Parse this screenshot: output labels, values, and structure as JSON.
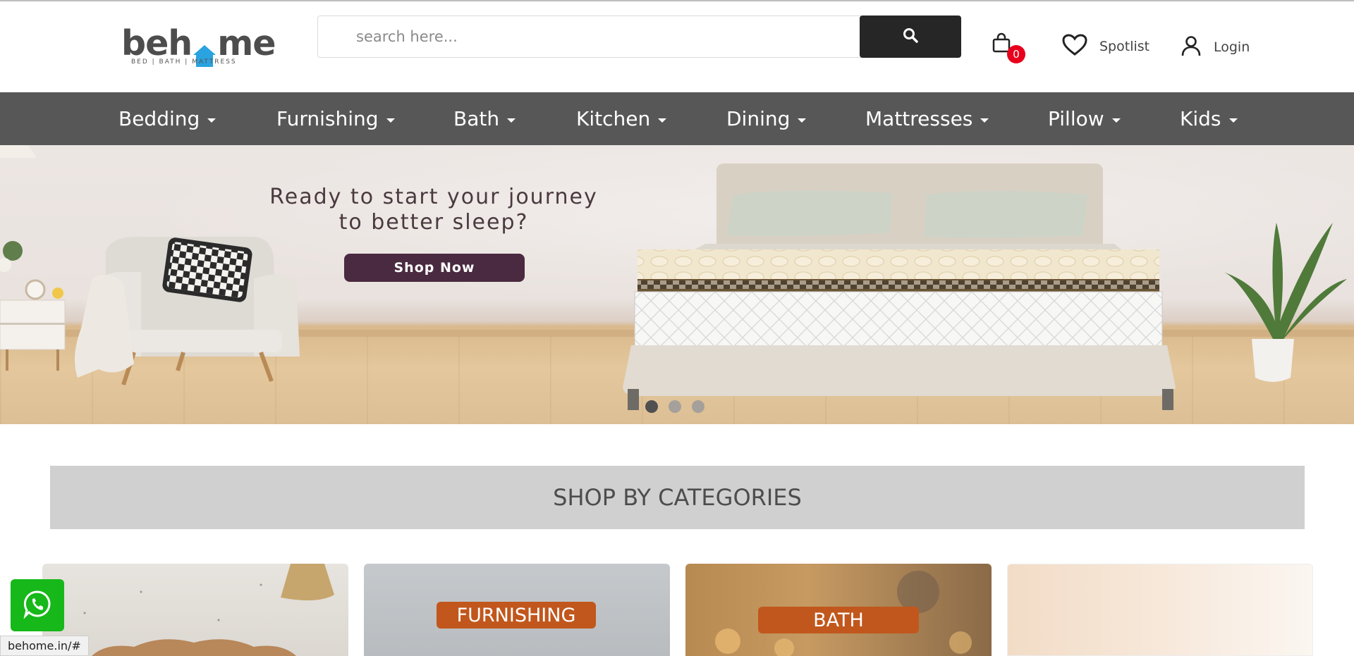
{
  "header": {
    "logo_text_pre": "beh",
    "logo_text_post": "me",
    "logo_tagline": "BED | BATH | MATTRESS",
    "search_placeholder": "search here...",
    "cart_count": "0",
    "spotlist_label": "Spotlist",
    "login_label": "Login"
  },
  "nav": {
    "items": [
      "Bedding",
      "Furnishing",
      "Bath",
      "Kitchen",
      "Dining",
      "Mattresses",
      "Pillow",
      "Kids"
    ]
  },
  "banner": {
    "title_line1": "Ready to start your journey",
    "title_line2": "to better sleep?",
    "cta_label": "Shop Now",
    "slide_count": 3,
    "active_slide": 1
  },
  "categories": {
    "heading": "SHOP BY CATEGORIES",
    "cards": [
      {
        "label": ""
      },
      {
        "label": "FURNISHING"
      },
      {
        "label": "BATH"
      },
      {
        "label": ""
      }
    ]
  },
  "status_bar": {
    "url": "behome.in/#"
  },
  "colors": {
    "nav_bg": "#575757",
    "search_button": "#262626",
    "cta_bg": "#4a2a40",
    "badge": "#e8001c",
    "logo_accent": "#2aa3e0",
    "category_label_bg": "#c1571c",
    "whatsapp": "#16b81a"
  },
  "icons": {
    "search": "search-icon",
    "cart": "shopping-bag-icon",
    "spotlist": "heart-icon",
    "login": "user-icon",
    "whatsapp": "whatsapp-icon"
  }
}
